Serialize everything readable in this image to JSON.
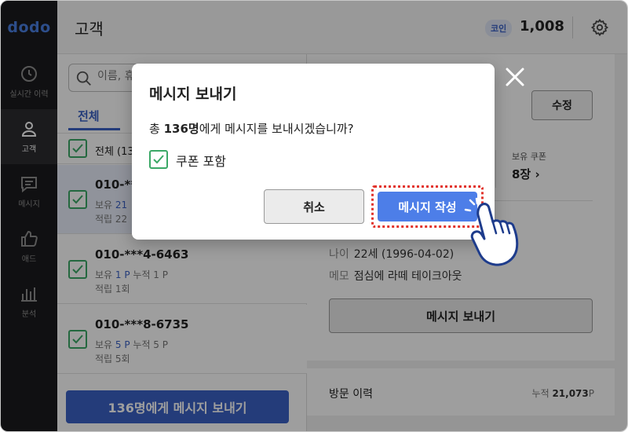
{
  "app": {
    "logo": "dodo"
  },
  "sidebar": {
    "items": [
      {
        "label": "실시간 이력",
        "icon": "clock-icon"
      },
      {
        "label": "고객",
        "icon": "person-icon",
        "active": true
      },
      {
        "label": "메시지",
        "icon": "message-icon"
      },
      {
        "label": "애드",
        "icon": "thumbs-up-icon"
      },
      {
        "label": "분석",
        "icon": "bar-chart-icon"
      }
    ]
  },
  "header": {
    "title": "고객",
    "coin_label": "코인",
    "coin_value": "1,008",
    "settings_icon": "gear-icon"
  },
  "list": {
    "search_placeholder": "이름, 휴",
    "tab_all": "전체",
    "header_label": "전체 (13",
    "rows": [
      {
        "phone": "010-**",
        "line2_prefix": "보유 ",
        "line2_value": "21",
        "line3": "적립 22"
      },
      {
        "phone": "010-***4-6463",
        "line2_prefix": "보유 ",
        "line2_value": "1 P",
        "line2_suffix": " 누적 1 P",
        "line3": "적립 1회"
      },
      {
        "phone": "010-***8-6735",
        "line2_prefix": "보유 ",
        "line2_value": "5 P",
        "line2_suffix": " 누적 5 P",
        "line3": "적립 5회"
      }
    ],
    "send_button": "136명에게 메시지 보내기"
  },
  "detail": {
    "edit_button": "수정",
    "coupon_label": "보유 쿠폰",
    "coupon_value": "8장",
    "age_key": "나이",
    "age_value": "22세 (1996-04-02)",
    "memo_key": "메모",
    "memo_value": "점심에 라떼 테이크아웃",
    "message_button": "메시지 보내기",
    "visit_key": "방문 이력",
    "visit_prefix": "누적 ",
    "visit_value": "21,073",
    "visit_unit": "P"
  },
  "modal": {
    "title": "메시지 보내기",
    "text_prefix": "총 ",
    "text_count": "136명",
    "text_suffix": "에게 메시지를 보내시겠습니까?",
    "checkbox_label": "쿠폰 포함",
    "cancel_button": "취소",
    "confirm_button": "메시지 작성"
  },
  "colors": {
    "accent": "#3a62c5",
    "confirm": "#4d7ee8",
    "check": "#3aa866",
    "highlight": "#e2342c"
  }
}
